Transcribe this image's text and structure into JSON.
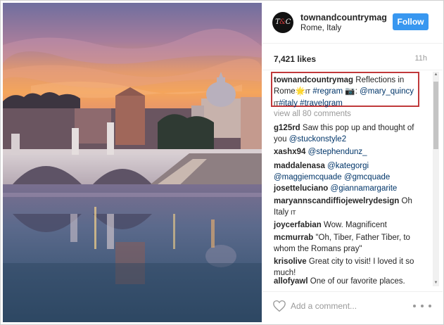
{
  "post": {
    "username": "townandcountrymag",
    "location": "Rome, Italy",
    "follow_label": "Follow",
    "likes": "7,421 likes",
    "time": "11h",
    "avatar_text_left": "T",
    "avatar_text_amp": "&",
    "avatar_text_right": "C",
    "photo_alt": "Rome, Italy"
  },
  "caption": {
    "username": "townandcountrymag",
    "text_1": "Reflections in Rome",
    "emoji_1": "🌟",
    "flag_1": "IT",
    "tag_1": "#regram",
    "camera_emoji": "📷",
    "colon": ":",
    "mention": "@mary_quincy",
    "flag_2": "IT",
    "tag_2": "#italy",
    "tag_3": "#travelgram"
  },
  "view_all": "view all 80 comments",
  "comments": [
    {
      "user": "g125rd",
      "text": "Saw this pop up and thought of you",
      "mention": "@stuckonstyle2"
    },
    {
      "user": "xashx94",
      "text": "",
      "mention": "@stephendunz_"
    },
    {
      "user": "maddalenasa",
      "text": "",
      "mention": "@kategorgi @maggiemcquade @gmcquade"
    },
    {
      "user": "josetteluciano",
      "text": "",
      "mention": "@giannamargarite"
    },
    {
      "user": "maryannscandiffiojewelrydesign",
      "text": "Oh Italy",
      "flag": "IT"
    },
    {
      "user": "joycerfabian",
      "text": "Wow. Magnificent"
    },
    {
      "user": "mcmurrab",
      "text": "\"Oh, Tiber, Father Tiber, to whom the Romans pray\""
    },
    {
      "user": "krisolive",
      "text": "Great city to visit! I loved it so much!"
    },
    {
      "user": "allofyawl",
      "text": "One of our favorite places."
    }
  ],
  "add_comment_placeholder": "Add a comment...",
  "icons": {
    "heart": "heart-outline-icon",
    "more": "more-options-icon"
  },
  "colors": {
    "follow": "#3897f0",
    "link": "#003569",
    "highlight": "#c0393b",
    "muted": "#999999"
  }
}
